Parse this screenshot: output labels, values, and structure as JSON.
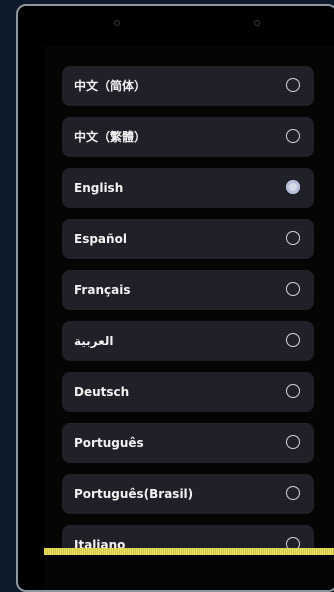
{
  "languages": [
    {
      "label": "中文（简体）",
      "selected": false
    },
    {
      "label": "中文（繁體）",
      "selected": false
    },
    {
      "label": "English",
      "selected": true
    },
    {
      "label": "Español",
      "selected": false
    },
    {
      "label": "Français",
      "selected": false
    },
    {
      "label": "العربية",
      "selected": false
    },
    {
      "label": "Deutsch",
      "selected": false
    },
    {
      "label": "Português",
      "selected": false
    },
    {
      "label": "Português(Brasil)",
      "selected": false
    },
    {
      "label": "Italiano",
      "selected": false
    }
  ],
  "colors": {
    "background": "#0c1a2b",
    "item_bg": "#23232c",
    "bezel": "#8e969e",
    "highlight_bar": "#e9e06a"
  }
}
